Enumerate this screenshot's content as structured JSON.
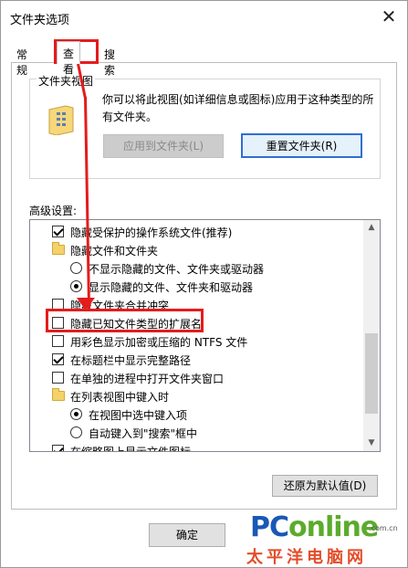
{
  "window": {
    "title": "文件夹选项",
    "close_glyph": "✕"
  },
  "tabs": [
    {
      "label": "常规"
    },
    {
      "label": "查看"
    },
    {
      "label": "搜索"
    }
  ],
  "folder_views": {
    "group_label": "文件夹视图",
    "description": "你可以将此视图(如详细信息或图标)应用于这种类型的所有文件夹。",
    "apply_button": "应用到文件夹(L)",
    "reset_button": "重置文件夹(R)"
  },
  "advanced": {
    "label": "高级设置:",
    "items": [
      {
        "kind": "checkbox",
        "checked": true,
        "indent": 1,
        "label": "隐藏受保护的操作系统文件(推荐)"
      },
      {
        "kind": "folder",
        "indent": 1,
        "label": "隐藏文件和文件夹"
      },
      {
        "kind": "radio",
        "checked": false,
        "indent": 2,
        "label": "不显示隐藏的文件、文件夹或驱动器"
      },
      {
        "kind": "radio",
        "checked": true,
        "indent": 2,
        "label": "显示隐藏的文件、文件夹和驱动器"
      },
      {
        "kind": "checkbox",
        "checked": false,
        "indent": 1,
        "label": "隐藏文件夹合并冲突"
      },
      {
        "kind": "checkbox",
        "checked": false,
        "indent": 1,
        "label": "隐藏已知文件类型的扩展名"
      },
      {
        "kind": "checkbox",
        "checked": false,
        "indent": 1,
        "label": "用彩色显示加密或压缩的 NTFS 文件"
      },
      {
        "kind": "checkbox",
        "checked": true,
        "indent": 1,
        "label": "在标题栏中显示完整路径"
      },
      {
        "kind": "checkbox",
        "checked": false,
        "indent": 1,
        "label": "在单独的进程中打开文件夹窗口"
      },
      {
        "kind": "folder",
        "indent": 1,
        "label": "在列表视图中键入时"
      },
      {
        "kind": "radio",
        "checked": true,
        "indent": 2,
        "label": "在视图中选中键入项"
      },
      {
        "kind": "radio",
        "checked": false,
        "indent": 2,
        "label": "自动键入到\"搜索\"框中"
      },
      {
        "kind": "checkbox",
        "checked": true,
        "indent": 1,
        "label": "在缩略图上显示文件图标"
      }
    ],
    "restore_button": "还原为默认值(D)"
  },
  "footer": {
    "ok_button": "确定"
  },
  "watermark": {
    "brand_pc": "PC",
    "brand_online": "online",
    "domain": ".com.cn",
    "chinese": "太平洋电脑网"
  },
  "colors": {
    "highlight": "#e41c1c",
    "focus_border": "#2f6fd1",
    "folder_yellow": "#f3d26c"
  }
}
